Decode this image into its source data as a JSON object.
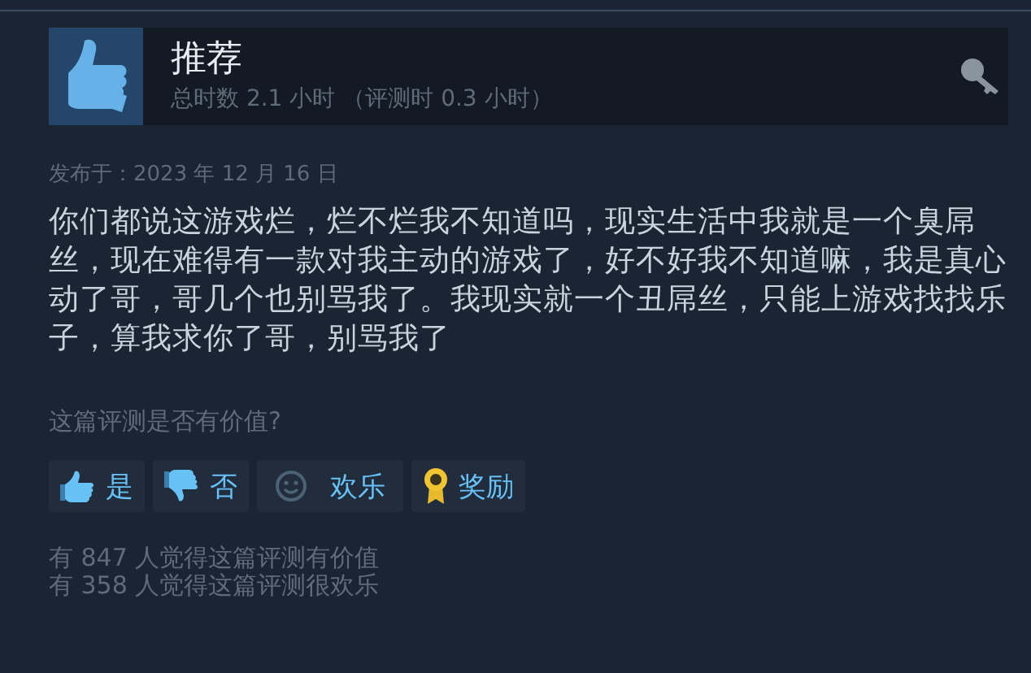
{
  "review": {
    "verdict": "推荐",
    "recommended": true,
    "playtime": "总时数 2.1 小时 （评测时 0.3 小时）",
    "posted": "发布于：2023 年 12 月 16 日",
    "body": "你们都说这游戏烂，烂不烂我不知道吗，现实生活中我就是一个臭屌丝，现在难得有一款对我主动的游戏了，好不好我不知道嘛，我是真心动了哥，哥几个也别骂我了。我现实就一个丑屌丝，只能上游戏找找乐子，算我求你了哥，别骂我了"
  },
  "feedback": {
    "question": "这篇评测是否有价值?",
    "buttons": [
      {
        "kind": "yes",
        "label": "是"
      },
      {
        "kind": "no",
        "label": "否"
      },
      {
        "kind": "funny",
        "label": "欢乐"
      },
      {
        "kind": "award",
        "label": "奖励"
      }
    ],
    "counts": [
      "有 847 人觉得这篇评测有价值",
      "有 358 人觉得这篇评测很欢乐"
    ]
  }
}
